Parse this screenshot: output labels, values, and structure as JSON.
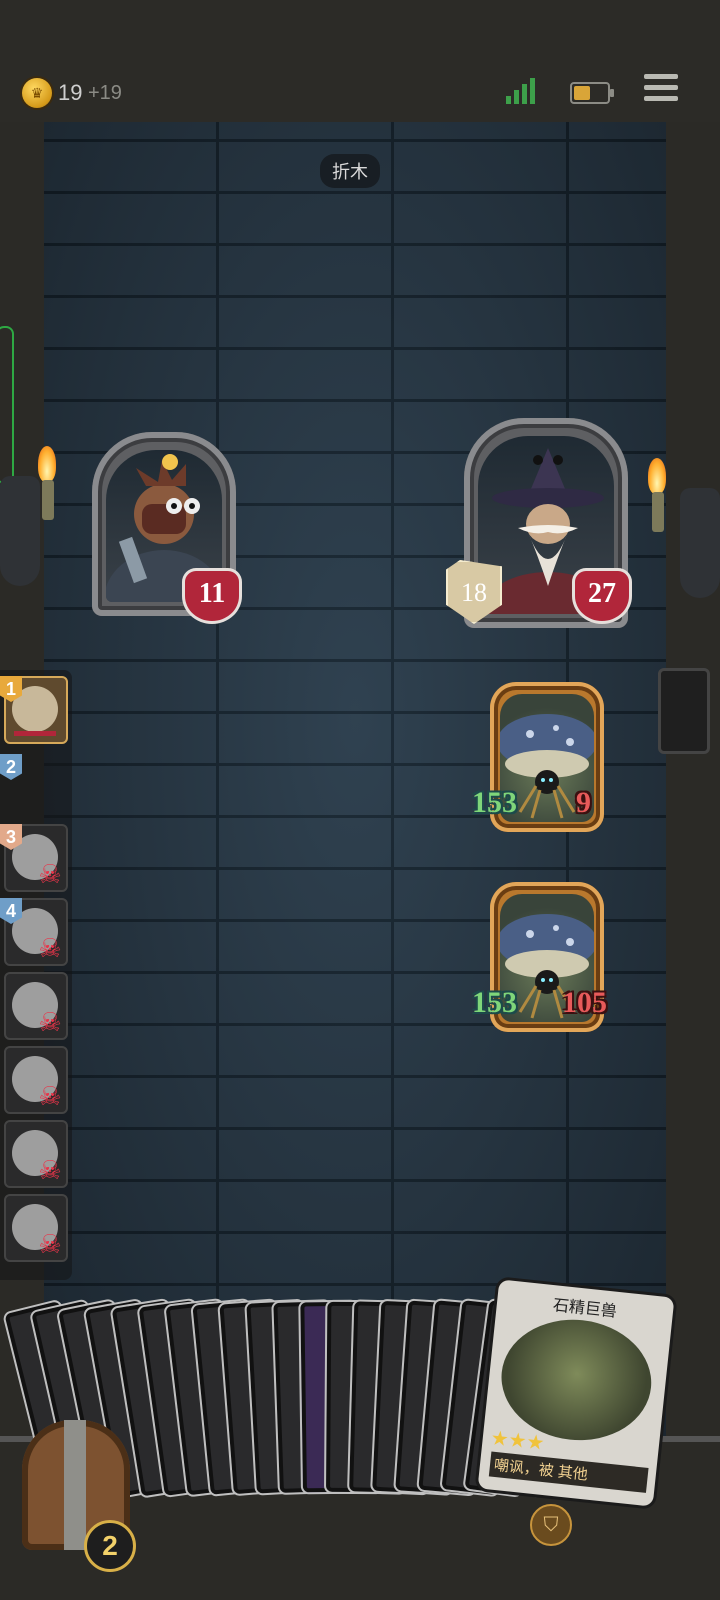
{
  "status_bar": {
    "gold": "19",
    "gold_income": "+19",
    "signal_bars": 4,
    "battery_level": 0.5
  },
  "room": {
    "name": "折木"
  },
  "party": [
    {
      "name": "hero-engineer",
      "hp": "11"
    },
    {
      "name": "hero-wizard",
      "attack": "18",
      "hp": "27"
    }
  ],
  "enemies": [
    {
      "name": "spider-mushroom-1",
      "defense": "153",
      "hp": "9"
    },
    {
      "name": "spider-mushroom-2",
      "defense": "153",
      "hp": "105"
    }
  ],
  "turn_queue": [
    {
      "index": "1",
      "state": "active",
      "badge_color": "#e8a93c"
    },
    {
      "index": "2",
      "state": "marker",
      "badge_color": "#6f9ec8"
    },
    {
      "index": "3",
      "state": "dead",
      "badge_color": "#e2a98a"
    },
    {
      "index": "4",
      "state": "dead",
      "badge_color": "#6f9ec8"
    },
    {
      "index": "",
      "state": "dead",
      "badge_color": ""
    },
    {
      "index": "",
      "state": "dead",
      "badge_color": ""
    },
    {
      "index": "",
      "state": "dead",
      "badge_color": ""
    },
    {
      "index": "",
      "state": "dead",
      "badge_color": ""
    }
  ],
  "hand": {
    "deck_count": "2",
    "featured_card": {
      "name": "石精巨兽",
      "stars": "★★★",
      "description": "嘲讽，被 其他"
    }
  },
  "colors": {
    "accent_gold": "#d6a95a",
    "heart_red": "#b1263a",
    "skull_red": "#e8354a"
  }
}
